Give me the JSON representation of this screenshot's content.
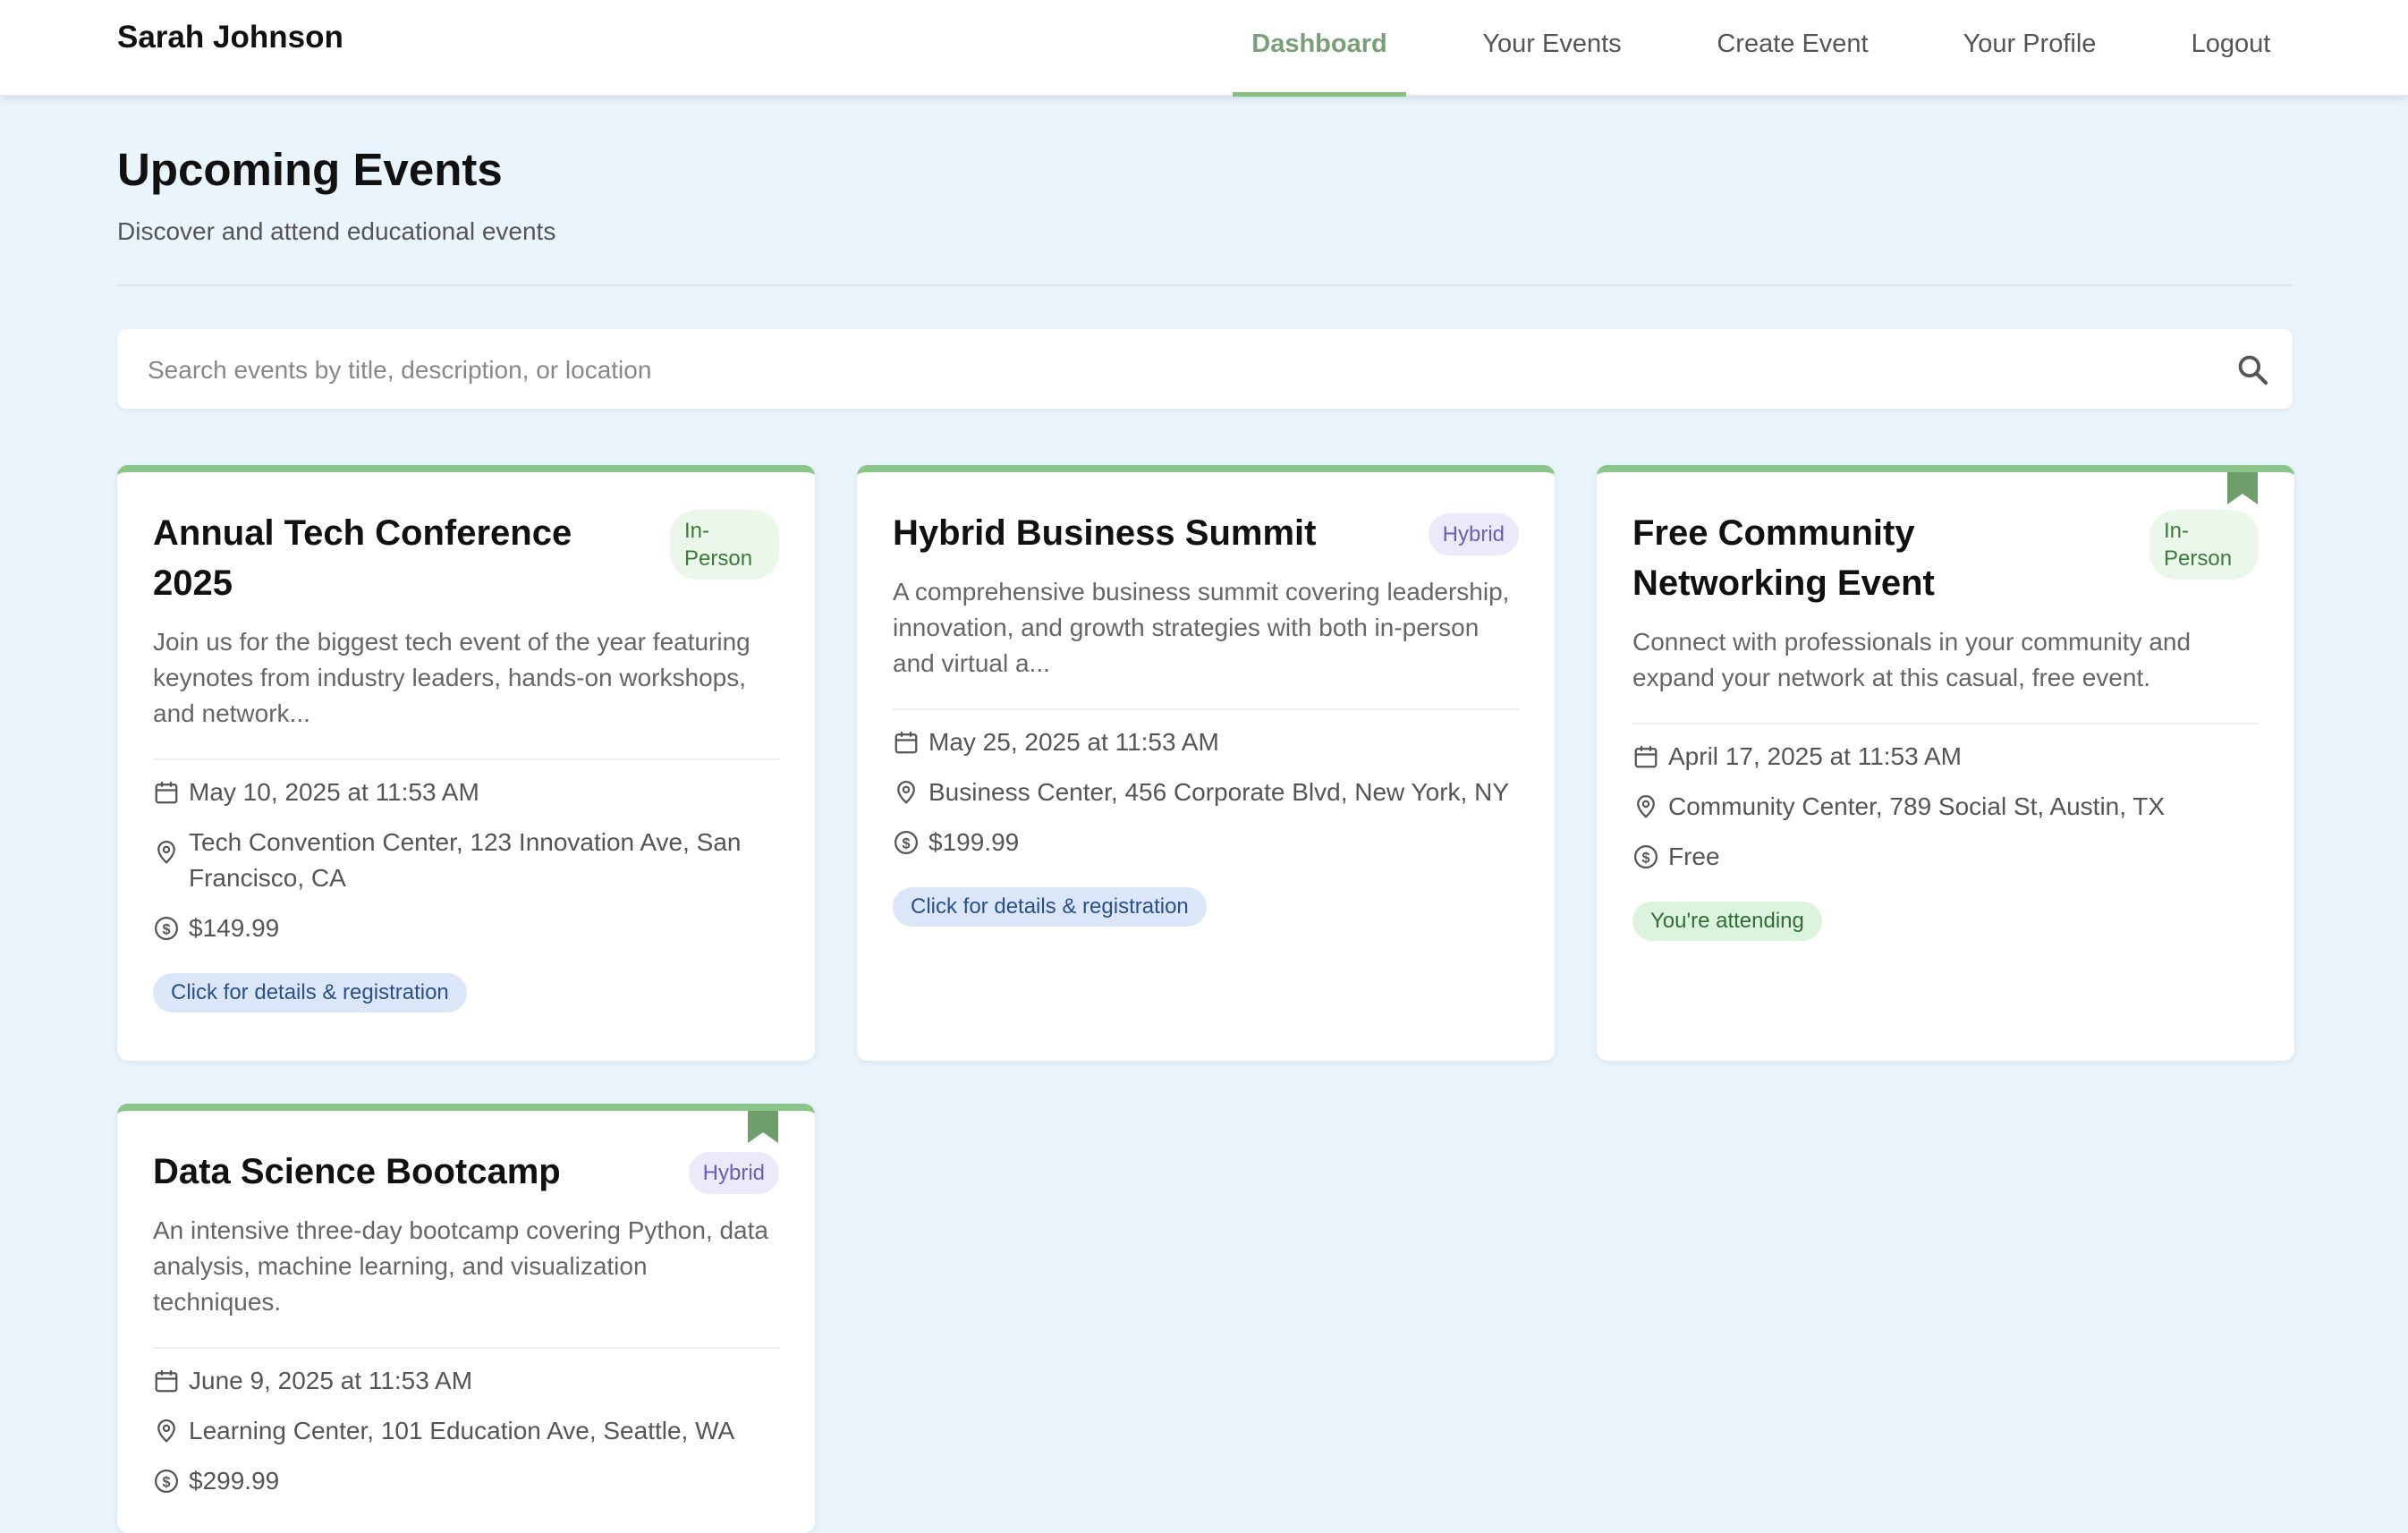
{
  "nav": {
    "brand": "Sarah Johnson",
    "items": [
      "Dashboard",
      "Your Events",
      "Create Event",
      "Your Profile",
      "Logout"
    ],
    "active": "Dashboard"
  },
  "header": {
    "title": "Upcoming Events",
    "subtitle": "Discover and attend educational events"
  },
  "search": {
    "placeholder": "Search events by title, description, or location",
    "value": ""
  },
  "colors": {
    "accent": "#86c083",
    "background": "#eaf4fd",
    "bookmark": "#6f9e6c"
  },
  "events": [
    {
      "title": "Annual Tech Conference 2025",
      "type": "In-Person",
      "description": "Join us for the biggest tech event of the year featuring keynotes from industry leaders, hands-on workshops, and network...",
      "date": "May 10, 2025 at 11:53 AM",
      "location": "Tech Convention Center, 123 Innovation Ave, San Francisco, CA",
      "price": "$149.99",
      "action": "Click for details & registration",
      "bookmarked": false
    },
    {
      "title": "Hybrid Business Summit",
      "type": "Hybrid",
      "description": "A comprehensive business summit covering leadership, innovation, and growth strategies with both in-person and virtual a...",
      "date": "May 25, 2025 at 11:53 AM",
      "location": "Business Center, 456 Corporate Blvd, New York, NY",
      "price": "$199.99",
      "action": "Click for details & registration",
      "bookmarked": false
    },
    {
      "title": "Free Community Networking Event",
      "type": "In-Person",
      "description": "Connect with professionals in your community and expand your network at this casual, free event.",
      "date": "April 17, 2025 at 11:53 AM",
      "location": "Community Center, 789 Social St, Austin, TX",
      "price": "Free",
      "action": "You're attending",
      "bookmarked": true
    },
    {
      "title": "Data Science Bootcamp",
      "type": "Hybrid",
      "description": "An intensive three-day bootcamp covering Python, data analysis, machine learning, and visualization techniques.",
      "date": "June 9, 2025 at 11:53 AM",
      "location": "Learning Center, 101 Education Ave, Seattle, WA",
      "price": "$299.99",
      "action": "",
      "bookmarked": true
    }
  ]
}
